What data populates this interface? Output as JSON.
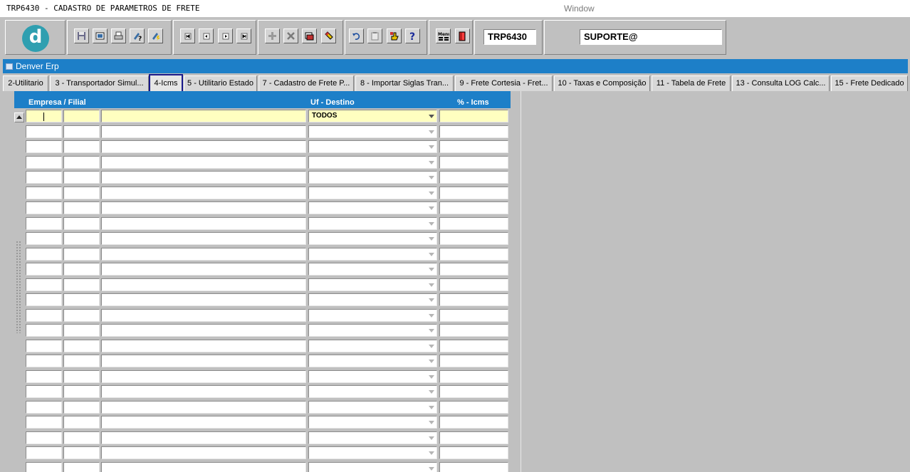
{
  "window": {
    "title": "TRP6430 - CADASTRO DE PARAMETROS DE FRETE",
    "menu_label": "Window"
  },
  "toolbar": {
    "logo_letter": "d",
    "buttons": [
      {
        "name": "save-icon"
      },
      {
        "name": "window-icon"
      },
      {
        "name": "print-icon"
      },
      {
        "name": "query-icon"
      },
      {
        "name": "execute-query-icon"
      },
      {
        "name": "first-record-icon"
      },
      {
        "name": "previous-record-icon"
      },
      {
        "name": "next-record-icon"
      },
      {
        "name": "last-record-icon"
      },
      {
        "name": "insert-record-icon"
      },
      {
        "name": "delete-record-icon"
      },
      {
        "name": "duplicate-record-icon"
      },
      {
        "name": "clear-record-icon"
      },
      {
        "name": "undo-icon"
      },
      {
        "name": "clipboard-icon"
      },
      {
        "name": "hand-icon"
      },
      {
        "name": "help-icon"
      },
      {
        "name": "menu-icon"
      },
      {
        "name": "exit-icon"
      }
    ],
    "form_code": "TRP6430",
    "user": "SUPORTE@"
  },
  "panel": {
    "title": "Denver Erp"
  },
  "tabs": [
    {
      "label": "2-Utilitario"
    },
    {
      "label": "3 - Transportador Simul..."
    },
    {
      "label": "4-Icms",
      "active": true
    },
    {
      "label": "5 - Utilitario Estado"
    },
    {
      "label": "7 - Cadastro de Frete P..."
    },
    {
      "label": "8 - Importar Siglas Tran..."
    },
    {
      "label": "9 - Frete Cortesia - Fret..."
    },
    {
      "label": "10 - Taxas e Composição"
    },
    {
      "label": "11 - Tabela de Frete"
    },
    {
      "label": "13 - Consulta LOG Calc..."
    },
    {
      "label": "15 - Frete Dedicado"
    }
  ],
  "grid": {
    "headers": {
      "empresa_filial": "Empresa / Filial",
      "uf_destino": "Uf - Destino",
      "pct_icms": "% - Icms"
    },
    "first_row": {
      "empresa": "",
      "filial": "",
      "descricao": "",
      "uf_destino": "TODOS",
      "pct_icms": ""
    },
    "row_count": 24
  }
}
